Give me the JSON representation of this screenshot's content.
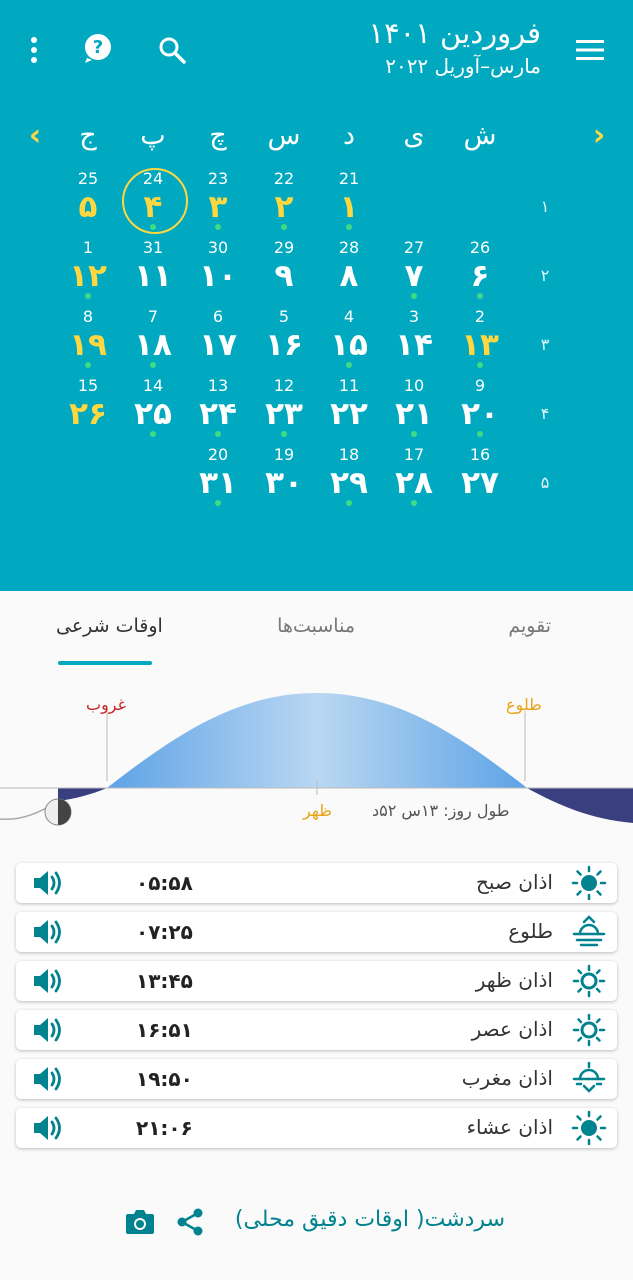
{
  "header": {
    "title": "فروردین ۱۴۰۱",
    "subtitle": "مارس–آوریل ۲۰۲۲",
    "menu_icon": "menu-icon",
    "search_icon": "search-icon",
    "help_icon": "help-icon",
    "more_icon": "more-vert-icon"
  },
  "calendar": {
    "weekdays": [
      "ش",
      "ی",
      "د",
      "س",
      "چ",
      "پ",
      "ج"
    ],
    "prev_icon": "chevron-left-icon",
    "next_icon": "chevron-right-icon",
    "week_numbers": [
      "۱",
      "۲",
      "۳",
      "۴",
      "۵"
    ],
    "days": [
      {
        "g": "21",
        "p": "۱",
        "hol": true,
        "dot": true
      },
      {
        "g": "22",
        "p": "۲",
        "hol": true,
        "dot": true
      },
      {
        "g": "23",
        "p": "۳",
        "hol": true,
        "dot": true
      },
      {
        "g": "24",
        "p": "۴",
        "hol": true,
        "dot": true,
        "today": true
      },
      {
        "g": "25",
        "p": "۵",
        "hol": true,
        "dot": false
      },
      {
        "g": "26",
        "p": "۶",
        "hol": false,
        "dot": true
      },
      {
        "g": "27",
        "p": "۷",
        "hol": false,
        "dot": true
      },
      {
        "g": "28",
        "p": "۸",
        "hol": false,
        "dot": false
      },
      {
        "g": "29",
        "p": "۹",
        "hol": false,
        "dot": false
      },
      {
        "g": "30",
        "p": "۱۰",
        "hol": false,
        "dot": false
      },
      {
        "g": "31",
        "p": "۱۱",
        "hol": false,
        "dot": false
      },
      {
        "g": "1",
        "p": "۱۲",
        "hol": true,
        "dot": true
      },
      {
        "g": "2",
        "p": "۱۳",
        "hol": true,
        "dot": true
      },
      {
        "g": "3",
        "p": "۱۴",
        "hol": false,
        "dot": false
      },
      {
        "g": "4",
        "p": "۱۵",
        "hol": false,
        "dot": true
      },
      {
        "g": "5",
        "p": "۱۶",
        "hol": false,
        "dot": false
      },
      {
        "g": "6",
        "p": "۱۷",
        "hol": false,
        "dot": false
      },
      {
        "g": "7",
        "p": "۱۸",
        "hol": false,
        "dot": true
      },
      {
        "g": "8",
        "p": "۱۹",
        "hol": true,
        "dot": true
      },
      {
        "g": "9",
        "p": "۲۰",
        "hol": false,
        "dot": true
      },
      {
        "g": "10",
        "p": "۲۱",
        "hol": false,
        "dot": true
      },
      {
        "g": "11",
        "p": "۲۲",
        "hol": false,
        "dot": false
      },
      {
        "g": "12",
        "p": "۲۳",
        "hol": false,
        "dot": true
      },
      {
        "g": "13",
        "p": "۲۴",
        "hol": false,
        "dot": true
      },
      {
        "g": "14",
        "p": "۲۵",
        "hol": false,
        "dot": true
      },
      {
        "g": "15",
        "p": "۲۶",
        "hol": true,
        "dot": false
      },
      {
        "g": "16",
        "p": "۲۷",
        "hol": false,
        "dot": false
      },
      {
        "g": "17",
        "p": "۲۸",
        "hol": false,
        "dot": true
      },
      {
        "g": "18",
        "p": "۲۹",
        "hol": false,
        "dot": true
      },
      {
        "g": "19",
        "p": "۳۰",
        "hol": false,
        "dot": false
      },
      {
        "g": "20",
        "p": "۳۱",
        "hol": false,
        "dot": true
      }
    ]
  },
  "tabs": [
    {
      "label": "تقویم",
      "active": false
    },
    {
      "label": "مناسبت‌ها",
      "active": false
    },
    {
      "label": "اوقات شرعی",
      "active": true
    }
  ],
  "sun_graph": {
    "sunrise_label": "طلوع",
    "sunset_label": "غروب",
    "noon_label": "ظهر",
    "day_length": "طول روز: ۱۳س ۵۲د",
    "colors": {
      "day": "#7fb8e8",
      "night": "#3a3f80",
      "sunrise": "#e8a317",
      "sunset": "#c62828"
    }
  },
  "prayer_times": [
    {
      "name": "اذان صبح",
      "time": "۰۵:۵۸",
      "icon": "sun-icon"
    },
    {
      "name": "طلوع",
      "time": "۰۷:۲۵",
      "icon": "sunrise-icon"
    },
    {
      "name": "اذان ظهر",
      "time": "۱۳:۴۵",
      "icon": "sun-outline-icon"
    },
    {
      "name": "اذان عصر",
      "time": "۱۶:۵۱",
      "icon": "sun-outline-icon"
    },
    {
      "name": "اذان مغرب",
      "time": "۱۹:۵۰",
      "icon": "sunset-icon"
    },
    {
      "name": "اذان عشاء",
      "time": "۲۱:۰۶",
      "icon": "sun-icon"
    }
  ],
  "footer": {
    "location": "سردشت( اوقات دقیق محلی)",
    "share_icon": "share-icon",
    "camera_icon": "camera-icon"
  },
  "colors": {
    "primary": "#00a9c0",
    "accent": "#ffd740",
    "teal_dark": "#00838f"
  }
}
